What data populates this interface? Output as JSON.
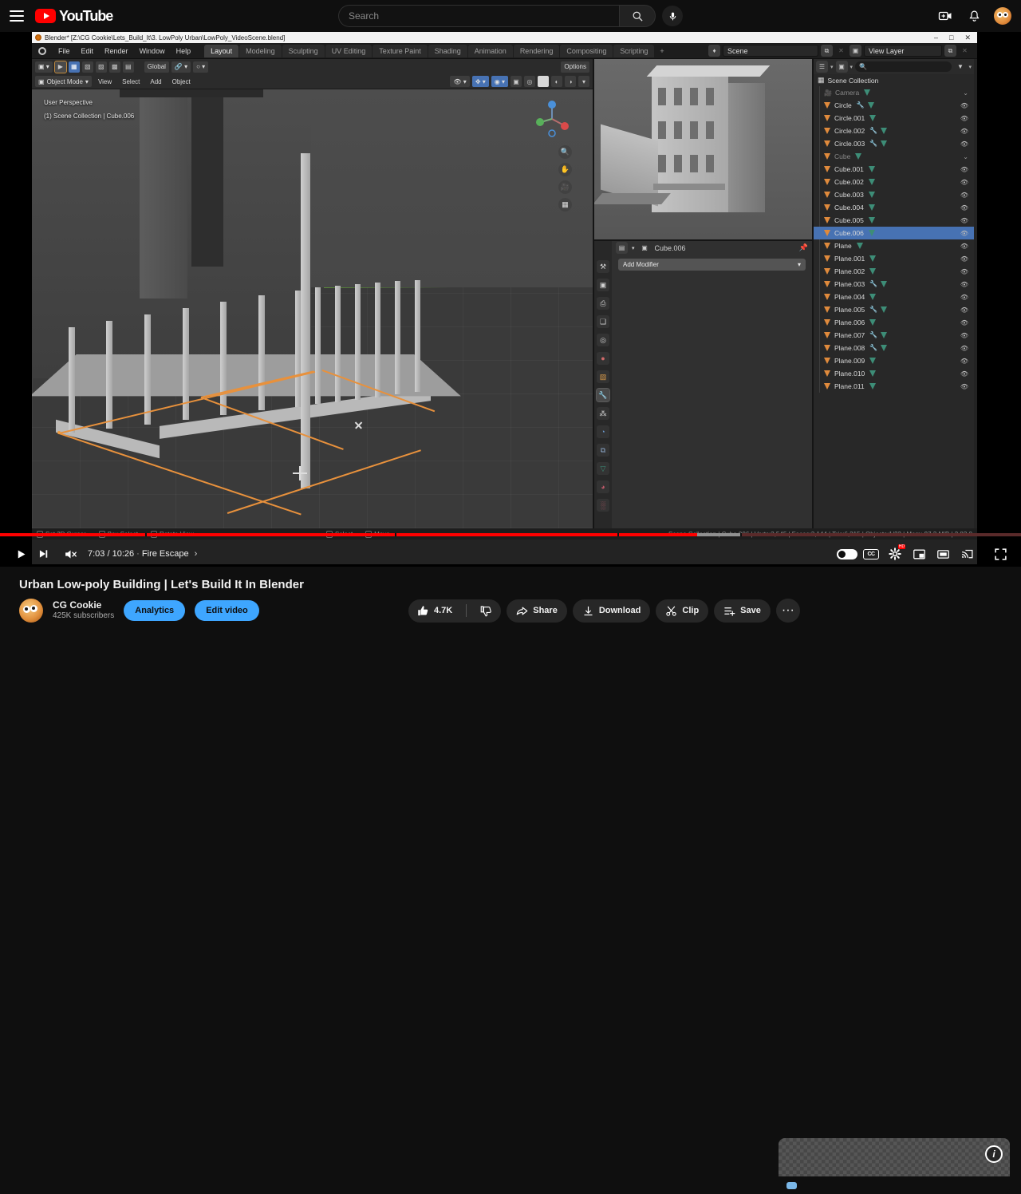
{
  "youtube": {
    "brand": "YouTube",
    "menu_icon": "hamburger-icon",
    "search": {
      "placeholder": "Search",
      "value": "",
      "search_icon": "search-icon",
      "mic_icon": "microphone-icon"
    },
    "right_icons": [
      {
        "name": "create-video-icon",
        "label": "Create"
      },
      {
        "name": "notifications-bell-icon",
        "label": "Notifications"
      },
      {
        "name": "account-avatar",
        "label": "Account"
      }
    ],
    "player": {
      "play_icon": "play-icon",
      "next_icon": "next-video-icon",
      "mute_icon": "volume-muted-icon",
      "current_time": "7:03",
      "duration": "10:26",
      "time_display": "7:03 / 10:26",
      "chapter": "Fire Escape",
      "chapter_chevron": "chevron-right-icon",
      "progress_percent": 68.3,
      "buffered_percent": 72.5,
      "controls_right": [
        {
          "name": "autoplay-toggle",
          "label": "Autoplay"
        },
        {
          "name": "subtitles-button",
          "label": "CC"
        },
        {
          "name": "settings-gear-button",
          "label": "Settings",
          "badge": "HD"
        },
        {
          "name": "miniplayer-button",
          "label": "Miniplayer"
        },
        {
          "name": "theater-button",
          "label": "Theater mode"
        },
        {
          "name": "cast-button",
          "label": "Play on TV"
        },
        {
          "name": "fullscreen-button",
          "label": "Full screen"
        }
      ]
    },
    "video": {
      "title": "Urban Low-poly Building | Let's Build It In Blender",
      "channel": "CG Cookie",
      "subscribers": "425K subscribers",
      "analytics_label": "Analytics",
      "edit_label": "Edit video",
      "like_count": "4.7K",
      "actions": [
        {
          "name": "share-button",
          "label": "Share",
          "icon": "share-arrow-icon"
        },
        {
          "name": "download-button",
          "label": "Download",
          "icon": "download-icon"
        },
        {
          "name": "clip-button",
          "label": "Clip",
          "icon": "scissors-icon"
        },
        {
          "name": "save-button",
          "label": "Save",
          "icon": "save-playlist-icon"
        }
      ],
      "more_label": "···"
    },
    "suggestion": {
      "info_badge": "i"
    }
  },
  "blender": {
    "titlebar": {
      "title": "Blender* [Z:\\CG Cookie\\Lets_Build_It\\3. LowPoly Urban\\LowPoly_VideoScene.blend]",
      "minimize": "–",
      "maximize": "□",
      "close": "✕"
    },
    "menus": [
      "File",
      "Edit",
      "Render",
      "Window",
      "Help"
    ],
    "workspaces": [
      {
        "label": "Layout",
        "active": true
      },
      {
        "label": "Modeling",
        "active": false
      },
      {
        "label": "Sculpting",
        "active": false
      },
      {
        "label": "UV Editing",
        "active": false
      },
      {
        "label": "Texture Paint",
        "active": false
      },
      {
        "label": "Shading",
        "active": false
      },
      {
        "label": "Animation",
        "active": false
      },
      {
        "label": "Rendering",
        "active": false
      },
      {
        "label": "Compositing",
        "active": false
      },
      {
        "label": "Scripting",
        "active": false
      },
      {
        "label": "+",
        "active": false
      }
    ],
    "topbar_right": {
      "scene": "Scene",
      "view_layer": "View Layer"
    },
    "viewport": {
      "mode": "Object Mode",
      "menus": [
        "View",
        "Select",
        "Add",
        "Object"
      ],
      "transform_orientation": "Global",
      "options_label": "Options",
      "overlay_line1": "User Perspective",
      "overlay_line2": "(1) Scene Collection | Cube.006",
      "gizmo_axes": [
        "X",
        "Y",
        "Z"
      ],
      "side_tools": [
        "zoom-icon",
        "pan-hand-icon",
        "camera-view-icon",
        "toggle-ortho-icon"
      ]
    },
    "properties": {
      "breadcrumb_object": "Cube.006",
      "add_modifier_label": "Add Modifier",
      "pin_icon": "pin-icon",
      "tabs": [
        {
          "name": "tool-tab",
          "glyph": "⚒",
          "active": false
        },
        {
          "name": "render-tab",
          "glyph": "▣",
          "active": false
        },
        {
          "name": "output-tab",
          "glyph": "⎙",
          "active": false
        },
        {
          "name": "view-layer-tab",
          "glyph": "❑",
          "active": false
        },
        {
          "name": "scene-tab",
          "glyph": "◎",
          "active": false
        },
        {
          "name": "world-tab",
          "glyph": "●",
          "active": false
        },
        {
          "name": "object-tab",
          "glyph": "▧",
          "active": false
        },
        {
          "name": "modifier-tab",
          "glyph": "🔧",
          "active": true
        },
        {
          "name": "particles-tab",
          "glyph": "⁂",
          "active": false
        },
        {
          "name": "physics-tab",
          "glyph": "◔",
          "active": false
        },
        {
          "name": "constraints-tab",
          "glyph": "⧉",
          "active": false
        },
        {
          "name": "data-tab",
          "glyph": "▽",
          "active": false
        },
        {
          "name": "material-tab",
          "glyph": "◕",
          "active": false
        },
        {
          "name": "texture-tab",
          "glyph": "░",
          "active": false
        }
      ]
    },
    "outliner": {
      "root": "Scene Collection",
      "search_placeholder": "",
      "filter_icon": "filter-icon",
      "items": [
        {
          "name": "Camera",
          "type": "camera",
          "dim": true,
          "selected": false,
          "modifier": false,
          "data": true,
          "eye": false,
          "chev": true
        },
        {
          "name": "Circle",
          "type": "mesh",
          "dim": false,
          "selected": false,
          "modifier": true,
          "data": true,
          "eye": true,
          "chev": false
        },
        {
          "name": "Circle.001",
          "type": "mesh",
          "dim": false,
          "selected": false,
          "modifier": false,
          "data": true,
          "eye": true,
          "chev": false
        },
        {
          "name": "Circle.002",
          "type": "mesh",
          "dim": false,
          "selected": false,
          "modifier": true,
          "data": true,
          "eye": true,
          "chev": false
        },
        {
          "name": "Circle.003",
          "type": "mesh",
          "dim": false,
          "selected": false,
          "modifier": true,
          "data": true,
          "eye": true,
          "chev": false
        },
        {
          "name": "Cube",
          "type": "mesh",
          "dim": true,
          "selected": false,
          "modifier": false,
          "data": true,
          "eye": false,
          "chev": true
        },
        {
          "name": "Cube.001",
          "type": "mesh",
          "dim": false,
          "selected": false,
          "modifier": false,
          "data": true,
          "eye": true,
          "chev": false
        },
        {
          "name": "Cube.002",
          "type": "mesh",
          "dim": false,
          "selected": false,
          "modifier": false,
          "data": true,
          "eye": true,
          "chev": false
        },
        {
          "name": "Cube.003",
          "type": "mesh",
          "dim": false,
          "selected": false,
          "modifier": false,
          "data": true,
          "eye": true,
          "chev": false
        },
        {
          "name": "Cube.004",
          "type": "mesh",
          "dim": false,
          "selected": false,
          "modifier": false,
          "data": true,
          "eye": true,
          "chev": false
        },
        {
          "name": "Cube.005",
          "type": "mesh",
          "dim": false,
          "selected": false,
          "modifier": false,
          "data": true,
          "eye": true,
          "chev": false
        },
        {
          "name": "Cube.006",
          "type": "mesh",
          "dim": false,
          "selected": true,
          "modifier": false,
          "data": true,
          "eye": true,
          "chev": false
        },
        {
          "name": "Plane",
          "type": "mesh",
          "dim": false,
          "selected": false,
          "modifier": false,
          "data": true,
          "eye": true,
          "chev": false
        },
        {
          "name": "Plane.001",
          "type": "mesh",
          "dim": false,
          "selected": false,
          "modifier": false,
          "data": true,
          "eye": true,
          "chev": false
        },
        {
          "name": "Plane.002",
          "type": "mesh",
          "dim": false,
          "selected": false,
          "modifier": false,
          "data": true,
          "eye": true,
          "chev": false
        },
        {
          "name": "Plane.003",
          "type": "mesh",
          "dim": false,
          "selected": false,
          "modifier": true,
          "data": true,
          "eye": true,
          "chev": false
        },
        {
          "name": "Plane.004",
          "type": "mesh",
          "dim": false,
          "selected": false,
          "modifier": false,
          "data": true,
          "eye": true,
          "chev": false
        },
        {
          "name": "Plane.005",
          "type": "mesh",
          "dim": false,
          "selected": false,
          "modifier": true,
          "data": true,
          "eye": true,
          "chev": false
        },
        {
          "name": "Plane.006",
          "type": "mesh",
          "dim": false,
          "selected": false,
          "modifier": false,
          "data": true,
          "eye": true,
          "chev": false
        },
        {
          "name": "Plane.007",
          "type": "mesh",
          "dim": false,
          "selected": false,
          "modifier": true,
          "data": true,
          "eye": true,
          "chev": false
        },
        {
          "name": "Plane.008",
          "type": "mesh",
          "dim": false,
          "selected": false,
          "modifier": true,
          "data": true,
          "eye": true,
          "chev": false
        },
        {
          "name": "Plane.009",
          "type": "mesh",
          "dim": false,
          "selected": false,
          "modifier": false,
          "data": true,
          "eye": true,
          "chev": false
        },
        {
          "name": "Plane.010",
          "type": "mesh",
          "dim": false,
          "selected": false,
          "modifier": false,
          "data": true,
          "eye": true,
          "chev": false
        },
        {
          "name": "Plane.011",
          "type": "mesh",
          "dim": false,
          "selected": false,
          "modifier": false,
          "data": true,
          "eye": true,
          "chev": false
        }
      ]
    },
    "statusbar": {
      "keys": [
        {
          "label": "Set 3D Cursor"
        },
        {
          "label": "Box Select"
        },
        {
          "label": "Rotate View"
        },
        {
          "label": "Select"
        },
        {
          "label": "Move"
        }
      ],
      "scene_stats": "Scene Collection | Cube.006 | Verts:3,545 | Faces:3,144 | Tris:6,215 | Objects:1/22 | Mem: 97.2 MiB | 2.83.0"
    }
  }
}
